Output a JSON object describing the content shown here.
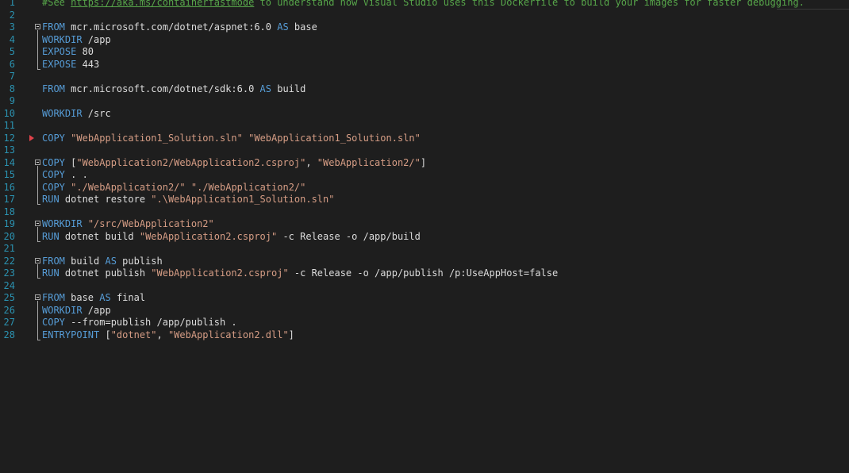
{
  "editor": {
    "lines": [
      {
        "n": "1",
        "tokens": [
          {
            "t": "#See ",
            "c": "cm"
          },
          {
            "t": "https://aka.ms/containerfastmode",
            "c": "link"
          },
          {
            "t": " to understand how Visual Studio uses this Dockerfile to build your images for faster debugging.",
            "c": "cm"
          }
        ]
      },
      {
        "n": "2",
        "tokens": []
      },
      {
        "n": "3",
        "fold": "start",
        "tokens": [
          {
            "t": "FROM",
            "c": "kw"
          },
          {
            "t": " mcr.microsoft.com/dotnet/aspnet:6.0 ",
            "c": "pl"
          },
          {
            "t": "AS",
            "c": "kw"
          },
          {
            "t": " base",
            "c": "pl"
          }
        ]
      },
      {
        "n": "4",
        "tokens": [
          {
            "t": "WORKDIR",
            "c": "kw"
          },
          {
            "t": " /app",
            "c": "pl"
          }
        ]
      },
      {
        "n": "5",
        "tokens": [
          {
            "t": "EXPOSE",
            "c": "kw"
          },
          {
            "t": " 80",
            "c": "pl"
          }
        ]
      },
      {
        "n": "6",
        "fold": "end",
        "tokens": [
          {
            "t": "EXPOSE",
            "c": "kw"
          },
          {
            "t": " 443",
            "c": "pl"
          }
        ]
      },
      {
        "n": "7",
        "tokens": []
      },
      {
        "n": "8",
        "tokens": [
          {
            "t": "FROM",
            "c": "kw"
          },
          {
            "t": " mcr.microsoft.com/dotnet/sdk:6.0 ",
            "c": "pl"
          },
          {
            "t": "AS",
            "c": "kw"
          },
          {
            "t": " build",
            "c": "pl"
          }
        ]
      },
      {
        "n": "9",
        "tokens": []
      },
      {
        "n": "10",
        "tokens": [
          {
            "t": "WORKDIR",
            "c": "kw"
          },
          {
            "t": " /src",
            "c": "pl"
          }
        ]
      },
      {
        "n": "11",
        "tokens": []
      },
      {
        "n": "12",
        "marker": true,
        "tokens": [
          {
            "t": "COPY",
            "c": "kw"
          },
          {
            "t": " ",
            "c": "pl"
          },
          {
            "t": "\"WebApplication1_Solution.sln\"",
            "c": "str"
          },
          {
            "t": " ",
            "c": "pl"
          },
          {
            "t": "\"WebApplication1_Solution.sln\"",
            "c": "str"
          }
        ]
      },
      {
        "n": "13",
        "tokens": []
      },
      {
        "n": "14",
        "fold": "start",
        "tokens": [
          {
            "t": "COPY",
            "c": "kw"
          },
          {
            "t": " [",
            "c": "pl"
          },
          {
            "t": "\"WebApplication2/WebApplication2.csproj\"",
            "c": "str"
          },
          {
            "t": ", ",
            "c": "pl"
          },
          {
            "t": "\"WebApplication2/\"",
            "c": "str"
          },
          {
            "t": "]",
            "c": "pl"
          }
        ]
      },
      {
        "n": "15",
        "tokens": [
          {
            "t": "COPY",
            "c": "kw"
          },
          {
            "t": " . .",
            "c": "pl"
          }
        ]
      },
      {
        "n": "16",
        "tokens": [
          {
            "t": "COPY",
            "c": "kw"
          },
          {
            "t": " ",
            "c": "pl"
          },
          {
            "t": "\"./WebApplication2/\"",
            "c": "str"
          },
          {
            "t": " ",
            "c": "pl"
          },
          {
            "t": "\"./WebApplication2/\"",
            "c": "str"
          }
        ]
      },
      {
        "n": "17",
        "fold": "end",
        "tokens": [
          {
            "t": "RUN",
            "c": "kw"
          },
          {
            "t": " dotnet restore ",
            "c": "pl"
          },
          {
            "t": "\".\\WebApplication1_Solution.sln\"",
            "c": "str"
          }
        ]
      },
      {
        "n": "18",
        "tokens": []
      },
      {
        "n": "19",
        "fold": "start",
        "tokens": [
          {
            "t": "WORKDIR",
            "c": "kw"
          },
          {
            "t": " ",
            "c": "pl"
          },
          {
            "t": "\"/src/WebApplication2\"",
            "c": "str"
          }
        ]
      },
      {
        "n": "20",
        "fold": "end",
        "tokens": [
          {
            "t": "RUN",
            "c": "kw"
          },
          {
            "t": " dotnet build ",
            "c": "pl"
          },
          {
            "t": "\"WebApplication2.csproj\"",
            "c": "str"
          },
          {
            "t": " -c Release -o /app/build",
            "c": "pl"
          }
        ]
      },
      {
        "n": "21",
        "tokens": []
      },
      {
        "n": "22",
        "fold": "start",
        "tokens": [
          {
            "t": "FROM",
            "c": "kw"
          },
          {
            "t": " build ",
            "c": "pl"
          },
          {
            "t": "AS",
            "c": "kw"
          },
          {
            "t": " publish",
            "c": "pl"
          }
        ]
      },
      {
        "n": "23",
        "fold": "end",
        "tokens": [
          {
            "t": "RUN",
            "c": "kw"
          },
          {
            "t": " dotnet publish ",
            "c": "pl"
          },
          {
            "t": "\"WebApplication2.csproj\"",
            "c": "str"
          },
          {
            "t": " -c Release -o /app/publish /p:UseAppHost=false",
            "c": "pl"
          }
        ]
      },
      {
        "n": "24",
        "tokens": []
      },
      {
        "n": "25",
        "fold": "start",
        "tokens": [
          {
            "t": "FROM",
            "c": "kw"
          },
          {
            "t": " base ",
            "c": "pl"
          },
          {
            "t": "AS",
            "c": "kw"
          },
          {
            "t": " final",
            "c": "pl"
          }
        ]
      },
      {
        "n": "26",
        "tokens": [
          {
            "t": "WORKDIR",
            "c": "kw"
          },
          {
            "t": " /app",
            "c": "pl"
          }
        ]
      },
      {
        "n": "27",
        "tokens": [
          {
            "t": "COPY",
            "c": "kw"
          },
          {
            "t": " --from=publish /app/publish .",
            "c": "pl"
          }
        ]
      },
      {
        "n": "28",
        "fold": "end",
        "tokens": [
          {
            "t": "ENTRYPOINT",
            "c": "kw"
          },
          {
            "t": " [",
            "c": "pl"
          },
          {
            "t": "\"dotnet\"",
            "c": "str"
          },
          {
            "t": ", ",
            "c": "pl"
          },
          {
            "t": "\"WebApplication2.dll\"",
            "c": "str"
          },
          {
            "t": "]",
            "c": "pl"
          }
        ]
      }
    ]
  }
}
